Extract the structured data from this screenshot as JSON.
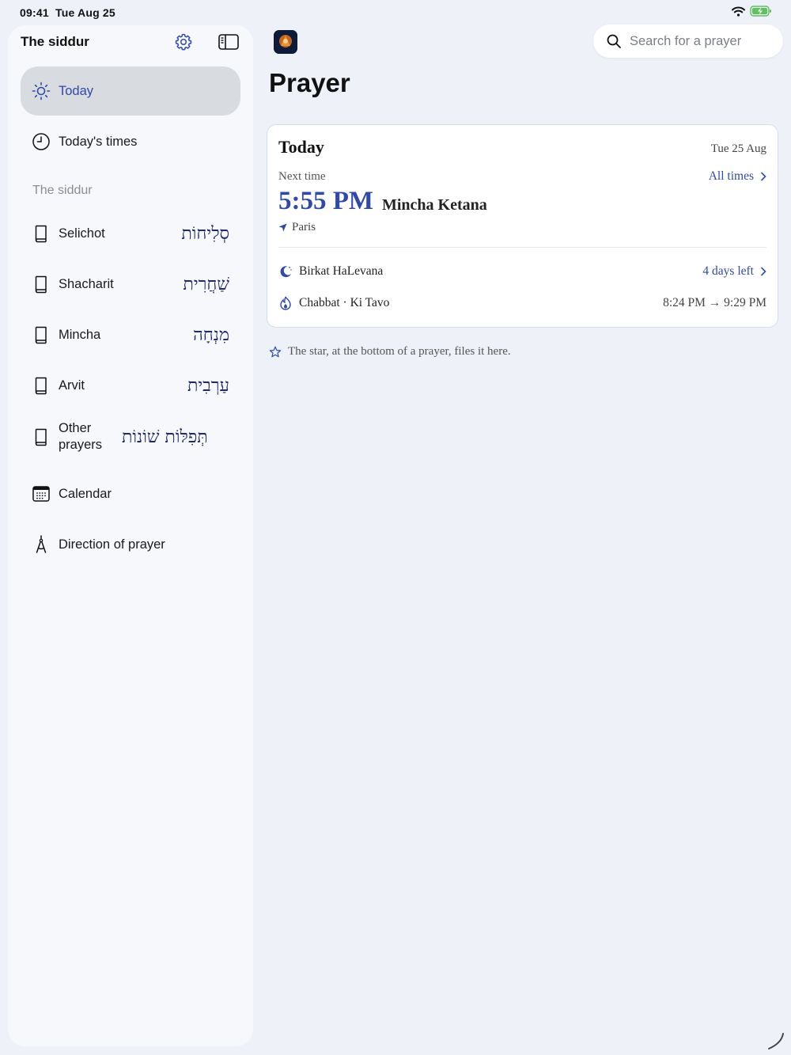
{
  "status": {
    "time": "09:41",
    "date": "Tue Aug 25"
  },
  "sidebar": {
    "title": "The siddur",
    "items": [
      {
        "label": "Today",
        "icon": "sun-icon",
        "active": true
      },
      {
        "label": "Today's times",
        "icon": "clock-icon"
      }
    ],
    "section_label": "The siddur",
    "siddur_items": [
      {
        "label": "Selichot",
        "hebrew": "סְלִיחוֹת",
        "icon": "book-icon"
      },
      {
        "label": "Shacharit",
        "hebrew": "שַׁחֲרִית",
        "icon": "book-icon"
      },
      {
        "label": "Mincha",
        "hebrew": "מִנְחָה",
        "icon": "book-icon"
      },
      {
        "label": "Arvit",
        "hebrew": "עַרְבִית",
        "icon": "book-icon"
      },
      {
        "label": "Other prayers",
        "hebrew": "תְּפִלּוֹת שׁוֹנוֹת",
        "icon": "book-icon"
      }
    ],
    "extra_items": [
      {
        "label": "Calendar",
        "icon": "calendar-icon"
      },
      {
        "label": "Direction of prayer",
        "icon": "compass-icon"
      }
    ]
  },
  "search": {
    "placeholder": "Search for a prayer"
  },
  "main": {
    "title": "Prayer",
    "card": {
      "title": "Today",
      "date": "Tue 25 Aug",
      "next_label": "Next time",
      "all_times": "All times",
      "time": "5:55 PM",
      "prayer": "Mincha Ketana",
      "location": "Paris",
      "rows": [
        {
          "label": "Birkat HaLevana",
          "value": "4 days left",
          "icon": "moon-icon"
        },
        {
          "label": "Chabbat · Ki Tavo",
          "value": "8:24 PM → 9:29 PM",
          "icon": "candle-flame-icon"
        }
      ]
    },
    "hint": "The star, at the bottom of a prayer, files it here."
  },
  "colors": {
    "accent": "#2f4aa8",
    "background": "#eef2f8",
    "sidebar": "#f7f8fb",
    "active_item": "#d8dbe0"
  }
}
